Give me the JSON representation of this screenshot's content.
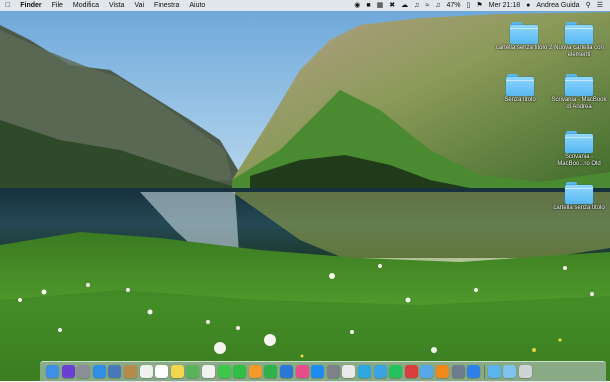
{
  "menubar": {
    "apple_icon": "apple-icon",
    "app_name": "Finder",
    "menus": [
      "File",
      "Modifica",
      "Vista",
      "Vai",
      "Finestra",
      "Aiuto"
    ],
    "battery_percent": "47%",
    "clock": "Mer 21:18",
    "user_name": "Andrea Guida"
  },
  "desktop": {
    "items": [
      {
        "label": "cartella senza titolo 2"
      },
      {
        "label": "Nuova cartella con elementi"
      },
      {
        "label": "Senza titolo"
      },
      {
        "label": "Scrivania - MacBook di Andrea"
      },
      {
        "label": "Scrivania - MacBoo...ro Old"
      },
      {
        "label": "cartella senza titolo"
      }
    ]
  },
  "dock": {
    "apps": [
      {
        "icon": "finder-icon",
        "color": "#3d8fe8"
      },
      {
        "icon": "siri-icon",
        "color": "#6a3fd1"
      },
      {
        "icon": "launchpad-icon",
        "color": "#8a8f99"
      },
      {
        "icon": "safari-icon",
        "color": "#2f8ee8"
      },
      {
        "icon": "photo-app-icon",
        "color": "#4a79b8"
      },
      {
        "icon": "notes-book-icon",
        "color": "#b58a4a"
      },
      {
        "icon": "reminders-icon",
        "color": "#f0f0f0"
      },
      {
        "icon": "calendar-icon",
        "color": "#ffffff"
      },
      {
        "icon": "stickies-icon",
        "color": "#f4d54e"
      },
      {
        "icon": "maps-icon",
        "color": "#59b35a"
      },
      {
        "icon": "photos-icon",
        "color": "#f2f2f2"
      },
      {
        "icon": "messages-icon",
        "color": "#3fc64b"
      },
      {
        "icon": "facetime-icon",
        "color": "#2fbf47"
      },
      {
        "icon": "pages-icon",
        "color": "#f39a2c"
      },
      {
        "icon": "numbers-icon",
        "color": "#2fb24a"
      },
      {
        "icon": "keynote-icon",
        "color": "#2a77d6"
      },
      {
        "icon": "itunes-icon",
        "color": "#e84c8b"
      },
      {
        "icon": "app-store-icon",
        "color": "#1e8bf0"
      },
      {
        "icon": "system-preferences-icon",
        "color": "#7d8188"
      },
      {
        "icon": "textedit-icon",
        "color": "#e9e9e9"
      },
      {
        "icon": "telegram-icon",
        "color": "#2ea6e0"
      },
      {
        "icon": "tweetbot-icon",
        "color": "#3aa3e3"
      },
      {
        "icon": "whatsapp-icon",
        "color": "#25c15b"
      },
      {
        "icon": "tasks-icon",
        "color": "#d93d3d"
      },
      {
        "icon": "cloud-icon",
        "color": "#58a7e6"
      },
      {
        "icon": "vlc-icon",
        "color": "#f08a1c"
      },
      {
        "icon": "preview-icon",
        "color": "#6f7c8d"
      },
      {
        "icon": "dropbox-icon",
        "color": "#2f7fe8"
      },
      {
        "icon": "downloads-folder-icon",
        "color": "#5ab4ee"
      },
      {
        "icon": "documents-folder-icon",
        "color": "#7fc3f0"
      },
      {
        "icon": "trash-icon",
        "color": "#cfd3d8"
      }
    ]
  }
}
